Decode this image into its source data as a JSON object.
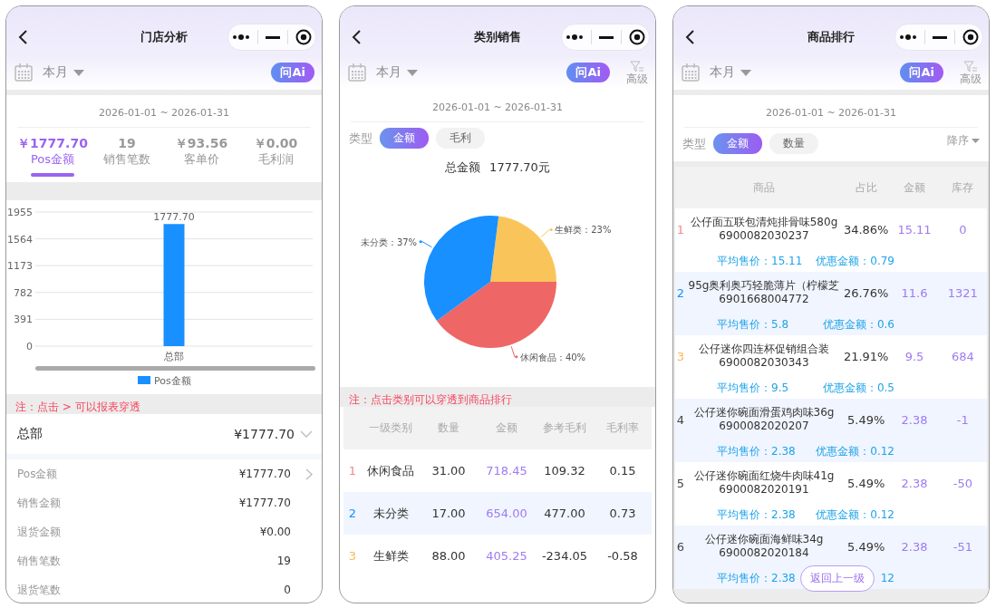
{
  "screens": [
    {
      "kind": "store",
      "title": "门店分析",
      "period": "本月",
      "ai_button": "问Ai",
      "date_range": "2026-01-01 ~ 2026-01-31",
      "metrics": [
        {
          "value": "￥1777.70",
          "label": "Pos金额",
          "selected": true
        },
        {
          "value": "19",
          "label": "销售笔数",
          "selected": false
        },
        {
          "value": "￥93.56",
          "label": "客单价",
          "selected": false
        },
        {
          "value": "￥0.00",
          "label": "毛利润",
          "selected": false
        }
      ],
      "chart_data": {
        "type": "bar",
        "categories": [
          "总部"
        ],
        "series": [
          {
            "name": "Pos金额",
            "color": "#1890ff",
            "values": [
              1780
            ]
          }
        ],
        "grid": true,
        "ylim": [
          0,
          1955
        ],
        "yticks": [
          0,
          391,
          782,
          1173,
          1564,
          1955
        ],
        "value_labels": [
          "1777.70"
        ]
      },
      "note": "注：点击 > 可以报表穿透",
      "group": {
        "name": "总部",
        "value": "¥1777.70",
        "expanded": true,
        "details": [
          {
            "label": "Pos金额",
            "value": "¥1777.70",
            "drill": true
          },
          {
            "label": "销售金额",
            "value": "¥1777.70",
            "drill": false
          },
          {
            "label": "退货金额",
            "value": "¥0.00",
            "drill": false
          },
          {
            "label": "销售笔数",
            "value": "19",
            "drill": false
          },
          {
            "label": "退货笔数",
            "value": "0",
            "drill": false
          }
        ]
      }
    },
    {
      "kind": "category",
      "title": "类别销售",
      "period": "本月",
      "ai_button": "问Ai",
      "filter_label": "高级",
      "date_range": "2026-01-01 ~ 2026-01-31",
      "type_label": "类型",
      "chips": [
        {
          "label": "金额",
          "selected": true
        },
        {
          "label": "毛利",
          "selected": false
        }
      ],
      "total_label": "总金额",
      "total_value": "1777.70元",
      "chart_data": {
        "type": "pie",
        "categories": [
          "生鲜类",
          "休闲食品",
          "未分类"
        ],
        "values": [
          23,
          40,
          37
        ],
        "colors": [
          "#f9c55a",
          "#ee6666",
          "#1890ff"
        ],
        "value_labels": [
          "：23%",
          "：40%",
          "：37%"
        ]
      },
      "note": "注：点击类别可以穿透到商品排行",
      "columns": [
        "一级类别",
        "数量",
        "金额",
        "参考毛利",
        "毛利率"
      ],
      "rows": [
        {
          "rank": "1",
          "color": "#f08a8a",
          "cells": [
            "休闲食品",
            "31.00",
            "718.45",
            "109.32",
            "0.15"
          ]
        },
        {
          "rank": "2",
          "color": "#1890ff",
          "cells": [
            "未分类",
            "17.00",
            "654.00",
            "477.00",
            "0.73"
          ]
        },
        {
          "rank": "3",
          "color": "#f7b955",
          "cells": [
            "生鲜类",
            "88.00",
            "405.25",
            "-234.05",
            "-0.58"
          ]
        }
      ]
    },
    {
      "kind": "ranking",
      "title": "商品排行",
      "period": "本月",
      "ai_button": "问Ai",
      "filter_label": "高级",
      "date_range": "2026-01-01 ~ 2026-01-31",
      "type_label": "类型",
      "chips": [
        {
          "label": "金额",
          "selected": true
        },
        {
          "label": "数量",
          "selected": false
        }
      ],
      "sort": "降序",
      "columns": [
        "商品",
        "占比",
        "金额",
        "库存"
      ],
      "rows": [
        {
          "rank": "1",
          "color": "#f08a8a",
          "name": "公仔面五联包清炖排骨味580g",
          "barcode": "6900082030237",
          "share": "34.86%",
          "amount": "15.11",
          "stock": "0",
          "avg_price": "平均售价：15.11",
          "discount": "优惠金额：0.79"
        },
        {
          "rank": "2",
          "color": "#1890ff",
          "name": "95g奥利奥巧轻脆薄片（柠檬芝",
          "barcode": "6901668004772",
          "share": "26.76%",
          "amount": "11.6",
          "stock": "1321",
          "avg_price": "平均售价：5.8",
          "discount": "优惠金额：0.6"
        },
        {
          "rank": "3",
          "color": "#f7b955",
          "name": "公仔迷你四连杯促销组合装",
          "barcode": "6900082030343",
          "share": "21.91%",
          "amount": "9.5",
          "stock": "684",
          "avg_price": "平均售价：9.5",
          "discount": "优惠金额：0.5"
        },
        {
          "rank": "4",
          "color": "#444444",
          "name": "公仔迷你碗面滑蛋鸡肉味36g",
          "barcode": "6900082020207",
          "share": "5.49%",
          "amount": "2.38",
          "stock": "-1",
          "avg_price": "平均售价：2.38",
          "discount": "优惠金额：0.12"
        },
        {
          "rank": "5",
          "color": "#444444",
          "name": "公仔迷你碗面红烧牛肉味41g",
          "barcode": "6900082020191",
          "share": "5.49%",
          "amount": "2.38",
          "stock": "-50",
          "avg_price": "平均售价：2.38",
          "discount": "优惠金额：0.12"
        },
        {
          "rank": "6",
          "color": "#444444",
          "name": "公仔迷你碗面海鲜味34g",
          "barcode": "6900082020184",
          "share": "5.49%",
          "amount": "2.38",
          "stock": "-51",
          "avg_price": "平均售价：2.38",
          "discount": "12"
        }
      ],
      "return_button": "返回上一级"
    }
  ]
}
